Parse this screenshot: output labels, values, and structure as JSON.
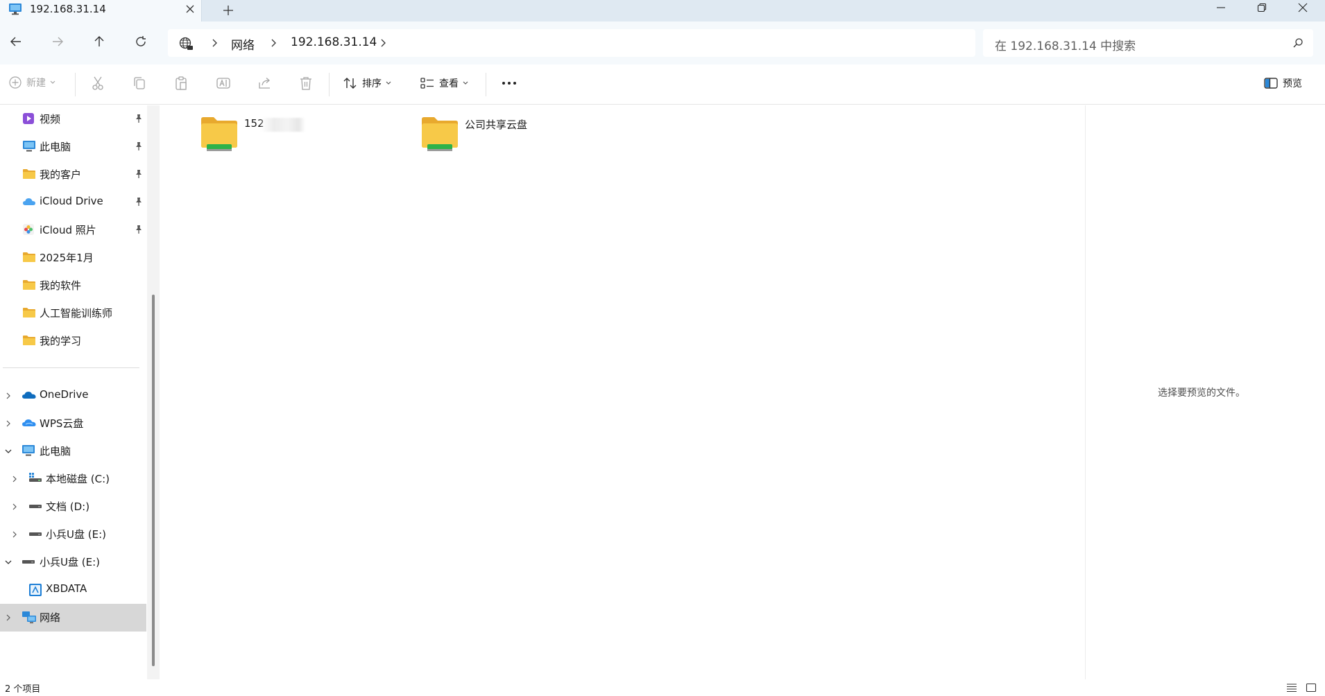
{
  "window": {
    "tab_title": "192.168.31.14",
    "controls": [
      "minimize-icon",
      "maximize-icon",
      "close-icon"
    ]
  },
  "address": {
    "breadcrumbs": [
      "网络",
      "192.168.31.14"
    ],
    "search_placeholder": "在 192.168.31.14 中搜索"
  },
  "toolbar": {
    "new_label": "新建",
    "sort_label": "排序",
    "view_label": "查看",
    "preview_label": "预览",
    "disabled_actions": [
      "cut-icon",
      "copy-icon",
      "paste-icon",
      "rename-icon",
      "share-icon",
      "delete-icon"
    ]
  },
  "sidebar": {
    "quick_access": [
      {
        "label": "视频",
        "icon": "video-folder-icon",
        "pinned": true
      },
      {
        "label": "此电脑",
        "icon": "computer-icon",
        "pinned": true
      },
      {
        "label": "我的客户",
        "icon": "folder-icon",
        "pinned": true
      },
      {
        "label": "iCloud Drive",
        "icon": "icloud-drive-icon",
        "pinned": true
      },
      {
        "label": "iCloud 照片",
        "icon": "icloud-photos-icon",
        "pinned": true
      },
      {
        "label": "2025年1月",
        "icon": "folder-icon",
        "pinned": false
      },
      {
        "label": "我的软件",
        "icon": "folder-icon",
        "pinned": false
      },
      {
        "label": "人工智能训练师",
        "icon": "folder-icon",
        "pinned": false
      },
      {
        "label": "我的学习",
        "icon": "folder-icon",
        "pinned": false
      }
    ],
    "tree": [
      {
        "label": "OneDrive",
        "icon": "onedrive-icon",
        "expanded": false
      },
      {
        "label": "WPS云盘",
        "icon": "wps-cloud-icon",
        "expanded": false
      },
      {
        "label": "此电脑",
        "icon": "computer-icon",
        "expanded": true
      },
      {
        "label": "本地磁盘 (C:)",
        "icon": "system-drive-icon",
        "expanded": false
      },
      {
        "label": "文档 (D:)",
        "icon": "drive-icon",
        "expanded": false
      },
      {
        "label": "小兵U盘 (E:)",
        "icon": "drive-icon",
        "expanded": false
      },
      {
        "label": "小兵U盘 (E:)",
        "icon": "drive-icon",
        "expanded": true
      },
      {
        "label": "XBDATA",
        "icon": "xbdata-icon",
        "expanded": false
      },
      {
        "label": "网络",
        "icon": "network-icon",
        "expanded": false,
        "selected": true
      }
    ]
  },
  "content": {
    "items": [
      {
        "label": "152",
        "icon": "shared-folder-icon",
        "label_obscured": true
      },
      {
        "label": "公司共享云盘",
        "icon": "shared-folder-icon"
      }
    ]
  },
  "preview": {
    "empty_text": "选择要预览的文件。"
  },
  "status": {
    "item_count": "2 个项目"
  },
  "colors": {
    "folder_yellow": "#f7c948",
    "share_bar_green": "#2db24a",
    "selected_bg": "#d7d7d7",
    "titlebar_bg": "#dfe9f2"
  }
}
